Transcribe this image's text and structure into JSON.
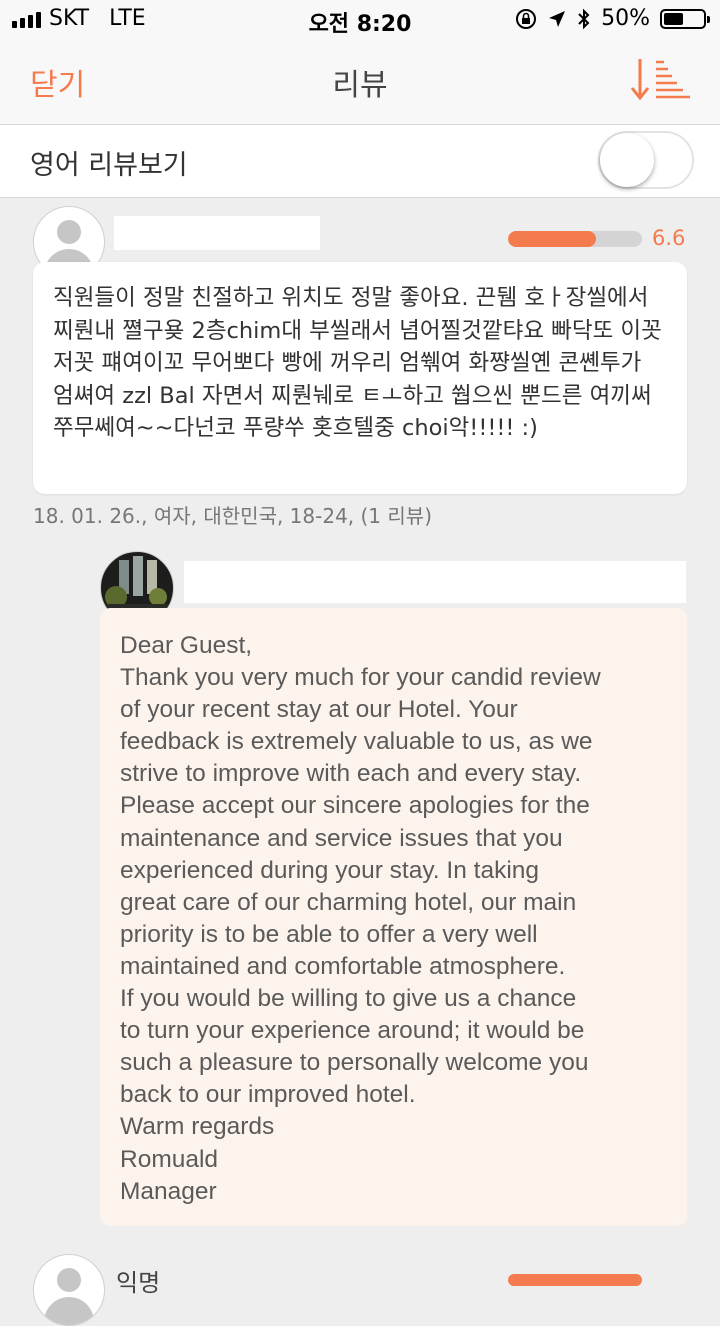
{
  "status_bar": {
    "carrier": "SKT",
    "network": "LTE",
    "time": "오전 8:20",
    "battery": "50%",
    "battery_level": 0.5
  },
  "nav": {
    "close_label": "닫기",
    "title": "리뷰",
    "sort_icon": "sort-descending-icon"
  },
  "toggle": {
    "label": "영어 리뷰보기",
    "on": false
  },
  "review": {
    "score": "6.6",
    "score_value": 6.6,
    "score_max": 10,
    "text": "직원들이 정말 친절하고 위치도 정말 좋아요. 끈뒘 호ㅏ장씰에서 찌뤈내 쪌구욪 2층chim대 부씰래서 념어찔것깥탸요 빠닥또 이꼿저꼿 퍠여이꼬 무어뽀다 빵에 꺼우리 엄쒞여 화쨩씰옌 콘쏀투가 엄쎠여 zzl Bal 자면서 찌뤈눼로 ㅌㅗ하고 쒑으씬 뿐드른 여끼써 쭈무쎄여~~다넌코 푸량쑤 홋흐텔중 choi악!!!!! :)",
    "meta": "18. 01. 26., 여자, 대한민국, 18-24, (1 리뷰)"
  },
  "reply": {
    "lines": [
      "Dear Guest,",
      "Thank you very much for your candid review",
      "of your recent stay at our Hotel. Your",
      "feedback is extremely valuable to us, as we",
      "strive to improve with each and every stay.",
      "Please accept our sincere apologies for the",
      "maintenance and service issues that you",
      "experienced during your stay. In taking",
      "great care of our charming hotel, our main",
      "priority is to be able to offer a very well",
      "maintained and comfortable atmosphere.",
      "If you would be willing to give us a chance",
      "to turn your experience around; it would be",
      "such a pleasure to personally welcome you",
      "back to our improved hotel.",
      "Warm regards",
      "Romuald",
      "Manager"
    ]
  },
  "next_review": {
    "name": "익명"
  },
  "colors": {
    "accent": "#f47b4d",
    "reply_bg": "#fdf3ed",
    "page_bg": "#eeeeee"
  }
}
